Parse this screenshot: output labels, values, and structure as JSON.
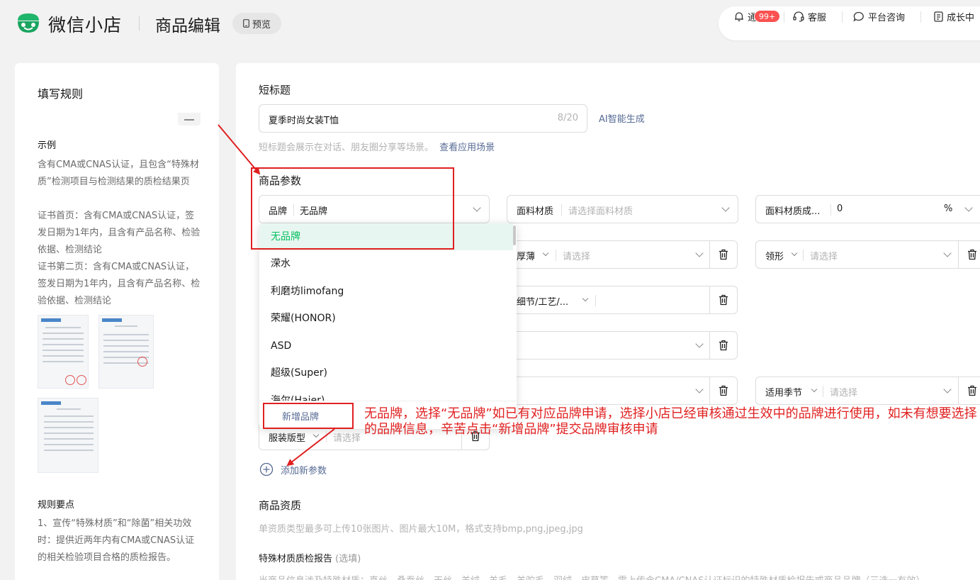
{
  "header": {
    "brand": "微信小店",
    "page_title": "商品编辑",
    "preview": "预览",
    "notify": "通知",
    "notify_badge": "99+",
    "service": "客服",
    "consult": "平台咨询",
    "growth": "成长中"
  },
  "left": {
    "title": "填写规则",
    "example_heading": "示例",
    "example_text": [
      "含有CMA或CNAS认证，且包含“特殊材质”检测项目与检测结果的质检结果页",
      "证书首页：含有CMA或CNAS认证，签发日期为1年内，且含有产品名称、检验依据、检测结论",
      "证书第二页：含有CMA或CNAS认证，签发日期为1年内，且含有产品名称、检验依据、检测结论"
    ],
    "rules_heading": "规则要点",
    "rules_text": "1、宣传“特殊材质”和“除菌”相关功效时：提供近两年内有CMA或CNAS认证的相关检验项目合格的质检报告。"
  },
  "short_title": {
    "label": "短标题",
    "value": "夏季时尚女装T恤",
    "count": "8/20",
    "ai": "AI智能生成",
    "hint": "短标题会展示在对话、朋友圈分享等场景。",
    "hint_link": "查看应用场景"
  },
  "params": {
    "label": "商品参数",
    "brand_label": "品牌",
    "brand_value": "无品牌",
    "fabric_label": "面料材质",
    "fabric_ph": "请选择面料材质",
    "composition_label": "面料材质成...",
    "composition_value": "0",
    "composition_unit": "%",
    "thickness_label": "厚薄",
    "thickness_ph": "请选择",
    "collar_label": "领形",
    "collar_ph": "请选择",
    "detail_label": "细节/工艺/...",
    "season_label": "适用季节",
    "season_ph": "请选择",
    "fit_label": "服装版型",
    "fit_ph": "请选择",
    "add_param": "添加新参数"
  },
  "brand_dropdown": {
    "options": [
      "无品牌",
      "溁水",
      "利磨坊limofang",
      "荣耀(HONOR)",
      "ASD",
      "超级(Super)",
      "海尔(Haier)"
    ],
    "add_brand": "新增品牌"
  },
  "qualification": {
    "label": "商品资质",
    "hint": "单资质类型最多可上传10张图片、图片最大10M，格式支持bmp,png,jpeg,jpg",
    "report_label": "特殊材质质检报告",
    "report_optional": "(选填)",
    "bottom_text": "当商品信息涉及特殊材质：真丝、桑蚕丝、天丝、羊绒、羊毛、羊驼毛、羽绒、皮草等，需上传含CMA/CNAS认证标识的特殊材质检报告或商品品牌（三选一有效）"
  },
  "annotation": {
    "text": "无品牌，选择“无品牌”如已有对应品牌申请，选择小店已经审核通过生效中的品牌进行使用，如未有想要选择的品牌信息，辛苦点击“新增品牌”提交品牌审核申请"
  },
  "colors": {
    "accent_green": "#07c160",
    "link_blue": "#576b95",
    "annotation_red": "#e02020",
    "badge_red": "#fa5151"
  }
}
